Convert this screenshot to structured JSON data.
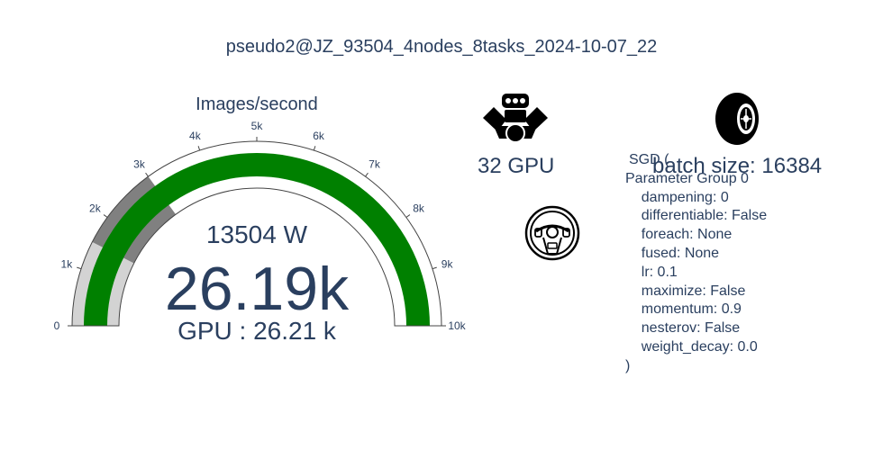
{
  "title": "pseudo2@JZ_93504_4nodes_8tasks_2024-10-07_22",
  "chart_data": {
    "type": "gauge",
    "title": "Images/second",
    "value": 26190,
    "value_label": "26.19k",
    "power_label": "13504 W",
    "gpu_label": "GPU : 26.21 k",
    "axis_range": [
      0,
      10000
    ],
    "ticks": [
      0,
      1000,
      2000,
      3000,
      4000,
      5000,
      6000,
      7000,
      8000,
      9000,
      10000
    ],
    "tick_labels": [
      "0",
      "1k",
      "2k",
      "3k",
      "4k",
      "5k",
      "6k",
      "7k",
      "8k",
      "9k",
      "10k"
    ],
    "steps": [
      {
        "range": [
          0,
          1500
        ],
        "color": "#d3d3d3"
      },
      {
        "range": [
          1500,
          3000
        ],
        "color": "#808080"
      }
    ],
    "bar_color": "#008000"
  },
  "gpu_text": "32 GPU",
  "batch_text": "batch size: 16384",
  "optimizer_lines": [
    "SGD (",
    "Parameter Group 0",
    "    dampening: 0",
    "    differentiable: False",
    "    foreach: None",
    "    fused: None",
    "    lr: 0.1",
    "    maximize: False",
    "    momentum: 0.9",
    "    nesterov: False",
    "    weight_decay: 0.0",
    ")"
  ],
  "icons": [
    "engine-icon",
    "tire-icon",
    "steering-wheel-icon"
  ]
}
